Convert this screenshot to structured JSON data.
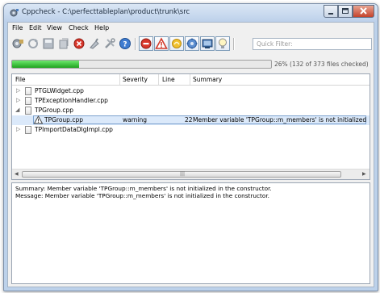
{
  "window": {
    "title": "Cppcheck - C:\\perfecttableplan\\product\\trunk\\src"
  },
  "menu": [
    "File",
    "Edit",
    "View",
    "Check",
    "Help"
  ],
  "toolbar": {
    "icons": [
      "check-directory-icon",
      "reload-icon",
      "save-results-icon",
      "open-results-icon",
      "stop-icon",
      "clear-icon",
      "settings-icon",
      "about-icon",
      "show-errors-icon",
      "show-warnings-icon",
      "show-style-icon",
      "show-performance-icon",
      "show-portability-icon",
      "show-information-icon"
    ],
    "filter_placeholder": "Quick Filter:"
  },
  "progress": {
    "value": 0.26,
    "label": "26% (132 of 373 files checked)"
  },
  "colors": {
    "progress_fill": "#2fb52f",
    "selection": "#dbe9fa",
    "accent_border": "#7da2ce"
  },
  "results": {
    "columns": [
      "File",
      "Severity",
      "Line",
      "Summary"
    ],
    "rows": [
      {
        "file": "PTGLWidget.cpp",
        "severity": "",
        "line": "",
        "summary": "",
        "expander": "collapsed"
      },
      {
        "file": "TPExceptionHandler.cpp",
        "severity": "",
        "line": "",
        "summary": "",
        "expander": "collapsed"
      },
      {
        "file": "TPGroup.cpp",
        "severity": "",
        "line": "",
        "summary": "",
        "expander": "expanded"
      },
      {
        "file": "TPGroup.cpp",
        "severity": "warning",
        "line": "22",
        "summary": "Member variable 'TPGroup::m_members' is not initialized",
        "expander": "none"
      },
      {
        "file": "TPImportDataDlgImpl.cpp",
        "severity": "",
        "line": "",
        "summary": "",
        "expander": "collapsed"
      }
    ]
  },
  "details": {
    "summary": "Summary: Member variable 'TPGroup::m_members' is not initialized in the constructor.",
    "message": "Message: Member variable 'TPGroup::m_members' is not initialized in the constructor."
  }
}
